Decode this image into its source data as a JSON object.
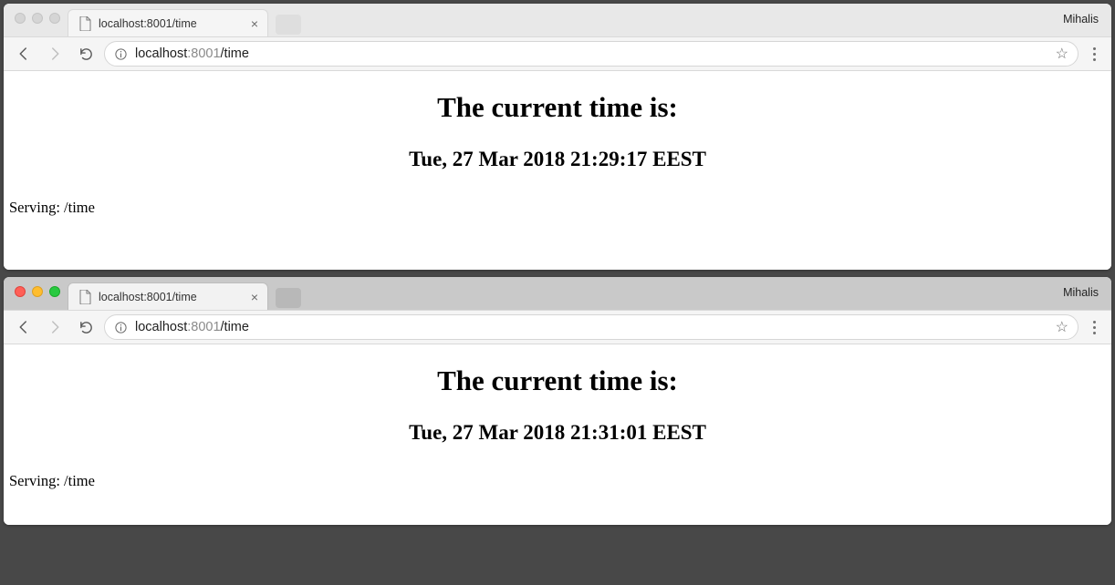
{
  "windows": [
    {
      "profile_name": "Mihalis",
      "tab_title": "localhost:8001/time",
      "addr_host": "localhost",
      "addr_port": ":8001",
      "addr_path": "/time",
      "page": {
        "heading": "The current time is:",
        "timestamp": "Tue, 27 Mar 2018 21:29:17 EEST",
        "serving": "Serving: /time"
      }
    },
    {
      "profile_name": "Mihalis",
      "tab_title": "localhost:8001/time",
      "addr_host": "localhost",
      "addr_port": ":8001",
      "addr_path": "/time",
      "page": {
        "heading": "The current time is:",
        "timestamp": "Tue, 27 Mar 2018 21:31:01 EEST",
        "serving": "Serving: /time"
      }
    }
  ]
}
